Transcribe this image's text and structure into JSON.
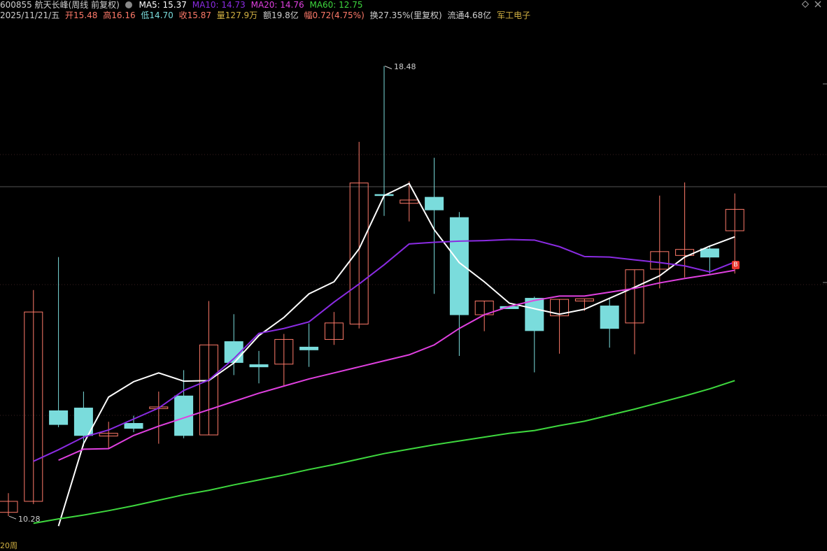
{
  "header": {
    "code_name": "600855 航天长峰(周线 前复权)",
    "ma5": "MA5: 15.37",
    "ma10": "MA10: 14.73",
    "ma20": "MA20: 14.76",
    "ma60": "MA60: 12.75",
    "date": "2025/11/21/五",
    "open": "开15.48",
    "high": "高16.16",
    "low": "低14.70",
    "close": "收15.87",
    "volume": "量127.9万",
    "amount": "额19.8亿",
    "change": "幅0.72(4.75%)",
    "turnover": "换27.35%(里复权)",
    "float": "流通4.68亿",
    "sector": "军工电子"
  },
  "colors": {
    "up": "#ff7a6a",
    "down": "#7adcdc",
    "ma5": "#ffffff",
    "ma10": "#8a2be2",
    "ma20": "#e040e0",
    "ma60": "#3ed83e",
    "grid": "#3a2020",
    "accent": "#d3b243"
  },
  "bottom_label": "20周",
  "badge_label": "B",
  "chart_data": {
    "type": "candlestick",
    "title": "600855 航天长峰(周线 前复权)",
    "ylim": [
      9.9,
      19.2
    ],
    "annotations": [
      {
        "text": "18.48",
        "value": 18.48,
        "at": 15
      },
      {
        "text": "10.28",
        "value": 10.28,
        "at": 0
      }
    ],
    "ohlc": [
      {
        "o": 10.35,
        "h": 10.7,
        "l": 10.28,
        "c": 10.55
      },
      {
        "o": 10.55,
        "h": 14.4,
        "l": 10.5,
        "c": 14.0
      },
      {
        "o": 12.2,
        "h": 15.0,
        "l": 11.9,
        "c": 11.95
      },
      {
        "o": 12.25,
        "h": 12.55,
        "l": 11.55,
        "c": 11.75
      },
      {
        "o": 11.74,
        "h": 12.0,
        "l": 11.5,
        "c": 11.79
      },
      {
        "o": 11.97,
        "h": 12.11,
        "l": 11.81,
        "c": 11.88
      },
      {
        "o": 12.24,
        "h": 12.55,
        "l": 11.6,
        "c": 12.27
      },
      {
        "o": 12.47,
        "h": 12.94,
        "l": 11.7,
        "c": 11.75
      },
      {
        "o": 11.76,
        "h": 14.2,
        "l": 11.76,
        "c": 13.4
      },
      {
        "o": 13.46,
        "h": 13.96,
        "l": 12.85,
        "c": 13.08
      },
      {
        "o": 13.04,
        "h": 13.29,
        "l": 12.7,
        "c": 13.0
      },
      {
        "o": 13.05,
        "h": 13.6,
        "l": 12.65,
        "c": 13.5
      },
      {
        "o": 13.36,
        "h": 13.79,
        "l": 13.0,
        "c": 13.31
      },
      {
        "o": 13.5,
        "h": 14.0,
        "l": 13.4,
        "c": 13.8
      },
      {
        "o": 13.78,
        "h": 17.1,
        "l": 13.7,
        "c": 16.35
      },
      {
        "o": 16.14,
        "h": 18.48,
        "l": 15.75,
        "c": 16.13
      },
      {
        "o": 15.98,
        "h": 16.38,
        "l": 15.65,
        "c": 16.04
      },
      {
        "o": 16.09,
        "h": 16.81,
        "l": 14.33,
        "c": 15.86
      },
      {
        "o": 15.72,
        "h": 15.82,
        "l": 13.2,
        "c": 13.95
      },
      {
        "o": 13.95,
        "h": 14.1,
        "l": 13.65,
        "c": 14.2
      },
      {
        "o": 14.1,
        "h": 14.1,
        "l": 14.35,
        "c": 14.06
      },
      {
        "o": 14.25,
        "h": 14.28,
        "l": 12.9,
        "c": 13.66
      },
      {
        "o": 13.93,
        "h": 14.18,
        "l": 13.24,
        "c": 14.23
      },
      {
        "o": 14.2,
        "h": 14.22,
        "l": 14.02,
        "c": 14.24
      },
      {
        "o": 14.11,
        "h": 14.26,
        "l": 13.35,
        "c": 13.7
      },
      {
        "o": 13.8,
        "h": 14.69,
        "l": 13.23,
        "c": 14.77
      },
      {
        "o": 14.78,
        "h": 16.12,
        "l": 14.43,
        "c": 15.1
      },
      {
        "o": 15.03,
        "h": 16.36,
        "l": 14.63,
        "c": 15.14
      },
      {
        "o": 15.15,
        "h": 15.2,
        "l": 14.7,
        "c": 15.0
      },
      {
        "o": 15.48,
        "h": 16.16,
        "l": 14.7,
        "c": 15.87
      }
    ],
    "series": [
      {
        "name": "MA5",
        "values": [
          10.1,
          11.6,
          12.45,
          12.73,
          12.89,
          12.74,
          12.75,
          13.07,
          13.57,
          13.9,
          14.33,
          14.55,
          15.15,
          16.12,
          16.34,
          15.5,
          14.9,
          14.55,
          14.16,
          14.06,
          13.96,
          14.05,
          14.25,
          14.45,
          14.66,
          15.0,
          15.2,
          15.37
        ]
      },
      {
        "name": "MA10",
        "values": [
          11.28,
          11.49,
          11.72,
          11.85,
          12.05,
          12.25,
          12.57,
          12.76,
          13.15,
          13.61,
          13.7,
          13.82,
          14.18,
          14.51,
          14.86,
          15.24,
          15.27,
          15.29,
          15.3,
          15.32,
          15.31,
          15.19,
          15.01,
          15.0,
          14.95,
          14.9,
          14.84,
          14.73,
          14.91
        ]
      },
      {
        "name": "MA20",
        "values": [
          11.3,
          11.5,
          11.51,
          11.75,
          11.92,
          12.07,
          12.22,
          12.37,
          12.52,
          12.65,
          12.78,
          12.89,
          13.0,
          13.11,
          13.22,
          13.4,
          13.7,
          13.95,
          14.1,
          14.21,
          14.29,
          14.29,
          14.36,
          14.43,
          14.53,
          14.61,
          14.68,
          14.76
        ]
      },
      {
        "name": "MA60",
        "values": [
          10.15,
          10.23,
          10.3,
          10.38,
          10.47,
          10.57,
          10.67,
          10.75,
          10.85,
          10.94,
          11.03,
          11.13,
          11.22,
          11.32,
          11.42,
          11.5,
          11.58,
          11.65,
          11.72,
          11.79,
          11.84,
          11.93,
          12.01,
          12.12,
          12.23,
          12.35,
          12.47,
          12.6,
          12.75
        ]
      }
    ]
  }
}
